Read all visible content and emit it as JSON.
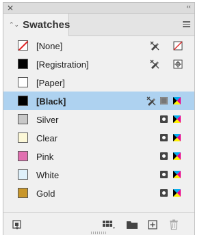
{
  "panel": {
    "tab_updown_glyph": "⌃⌄",
    "tab_title": "Swatches",
    "close_glyph": "✕",
    "collapse_glyph": "‹‹"
  },
  "swatches": [
    {
      "name": "[None]",
      "color": "none",
      "edit_locked": true,
      "mode": "none",
      "selected": false
    },
    {
      "name": "[Registration]",
      "color": "#000000",
      "edit_locked": true,
      "mode": "registration",
      "selected": false
    },
    {
      "name": "[Paper]",
      "color": "#ffffff",
      "edit_locked": false,
      "mode": "",
      "selected": false
    },
    {
      "name": "[Black]",
      "color": "#000000",
      "edit_locked": true,
      "mode": "process",
      "selected": true
    },
    {
      "name": "Silver",
      "color": "#c8c8c8",
      "edit_locked": false,
      "mode": "process",
      "selected": false
    },
    {
      "name": "Clear",
      "color": "#fcf8d8",
      "edit_locked": false,
      "mode": "process",
      "selected": false
    },
    {
      "name": "Pink",
      "color": "#e070b0",
      "edit_locked": false,
      "mode": "process",
      "selected": false
    },
    {
      "name": "White",
      "color": "#dff0fa",
      "edit_locked": false,
      "mode": "process",
      "selected": false
    },
    {
      "name": "Gold",
      "color": "#c8962a",
      "edit_locked": false,
      "mode": "process",
      "selected": false
    }
  ],
  "colors": {
    "selection": "#aed2f0",
    "none_slash": "#e02020"
  }
}
